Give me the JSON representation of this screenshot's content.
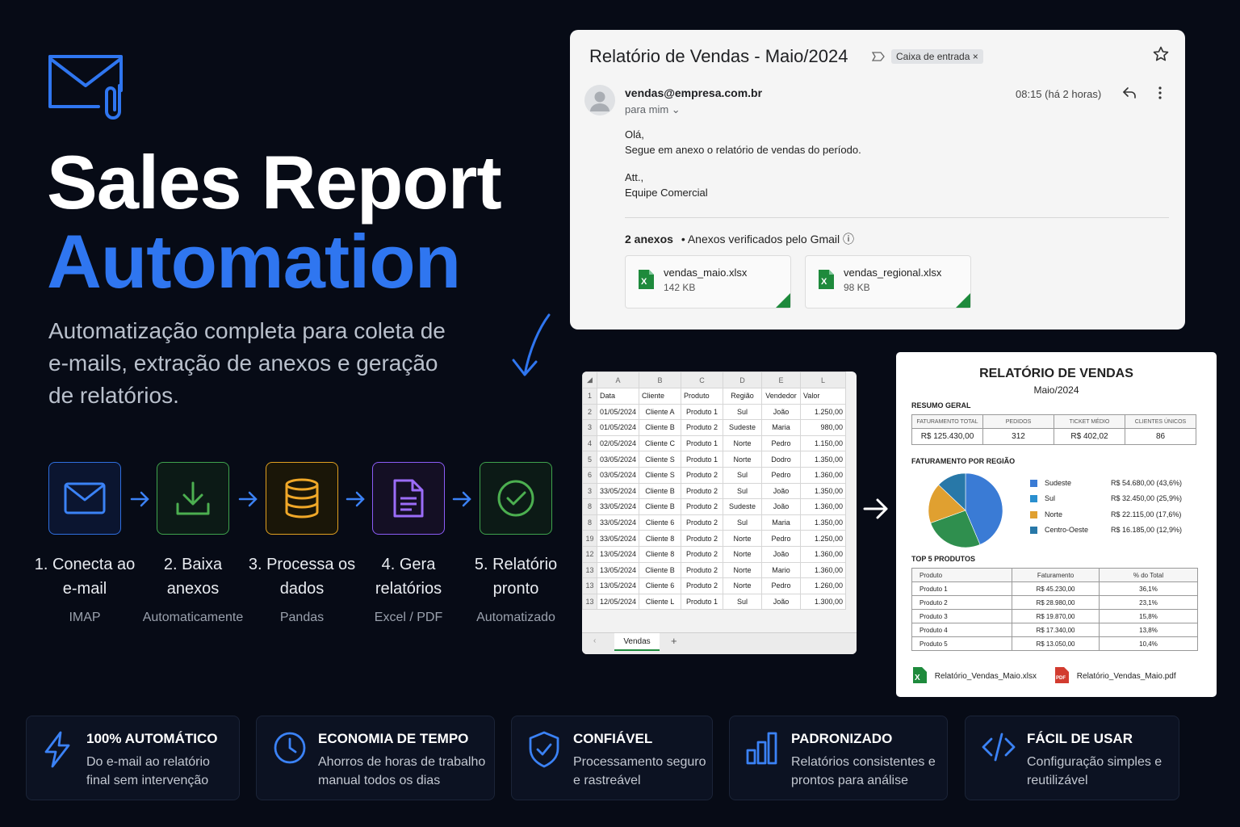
{
  "hero": {
    "title_line1": "Sales Report",
    "title_line2": "Automation",
    "subtitle": "Automatização completa para coleta de e-mails, extração de anexos e geração de relatórios."
  },
  "colors": {
    "accent": "#2f76f0",
    "background": "#070b16",
    "excel_green": "#1e8a3c"
  },
  "steps": [
    {
      "label": "1. Conecta ao e-mail",
      "sub": "IMAP",
      "icon": "mail-icon",
      "color": "#2f6fe0"
    },
    {
      "label": "2. Baixa anexos",
      "sub": "Automaticamente",
      "icon": "download-icon",
      "color": "#3fa34d"
    },
    {
      "label": "3. Processa os dados",
      "sub": "Pandas",
      "icon": "database-icon",
      "color": "#e0a020"
    },
    {
      "label": "4. Gera relatórios",
      "sub": "Excel / PDF",
      "icon": "document-icon",
      "color": "#8b5cf6"
    },
    {
      "label": "5. Relatório pronto",
      "sub": "Automatizado",
      "icon": "check-circle-icon",
      "color": "#3fa34d"
    }
  ],
  "email": {
    "subject": "Relatório de Vendas - Maio/2024",
    "label_chip": "Caixa de entrada ×",
    "sender": "vendas@empresa.com.br",
    "to": "para mim ⌄",
    "time": "08:15 (há 2 horas)",
    "body": [
      "Olá,",
      "Segue em anexo o relatório de vendas do período.",
      "",
      "Att.,",
      "Equipe Comercial"
    ],
    "attachments_count": "2 anexos",
    "attachments_note": "•  Anexos verificados pelo Gmail ⓘ",
    "attachments": [
      {
        "name": "vendas_maio.xlsx",
        "size": "142 KB"
      },
      {
        "name": "vendas_regional.xlsx",
        "size": "98 KB"
      }
    ]
  },
  "sheet": {
    "columns": [
      "A",
      "B",
      "C",
      "D",
      "E",
      "L"
    ],
    "headers": [
      "Data",
      "Cliente",
      "Produto",
      "Região",
      "Vendedor",
      "Valor"
    ],
    "row_numbers": [
      "1",
      "2",
      "3",
      "4",
      "5",
      "6",
      "3",
      "8",
      "8",
      "19",
      "12",
      "13",
      "13",
      "13"
    ],
    "rows": [
      [
        "01/05/2024",
        "Cliente A",
        "Produto 1",
        "Sul",
        "João",
        "1.250,00"
      ],
      [
        "01/05/2024",
        "Cliente B",
        "Produto 2",
        "Sudeste",
        "Maria",
        "980,00"
      ],
      [
        "02/05/2024",
        "Cliente C",
        "Produto 1",
        "Norte",
        "Pedro",
        "1.150,00"
      ],
      [
        "03/05/2024",
        "Cliente S",
        "Produto 1",
        "Norte",
        "Dodro",
        "1.350,00"
      ],
      [
        "03/05/2024",
        "Cliente S",
        "Produto 2",
        "Sul",
        "Pedro",
        "1.360,00"
      ],
      [
        "33/05/2024",
        "Cliente B",
        "Produto 2",
        "Sul",
        "João",
        "1.350,00"
      ],
      [
        "33/05/2024",
        "Cliente B",
        "Produto 2",
        "Sudeste",
        "João",
        "1.360,00"
      ],
      [
        "33/05/2024",
        "Cliente 6",
        "Produto 2",
        "Sul",
        "Maria",
        "1.350,00"
      ],
      [
        "33/05/2024",
        "Cliente 8",
        "Produto 2",
        "Norte",
        "Pedro",
        "1.250,00"
      ],
      [
        "13/05/2024",
        "Cliente 8",
        "Produto 2",
        "Norte",
        "João",
        "1.360,00"
      ],
      [
        "13/05/2024",
        "Cliente B",
        "Produto 2",
        "Norte",
        "Mario",
        "1.360,00"
      ],
      [
        "13/05/2024",
        "Cliente 6",
        "Produto 2",
        "Norte",
        "Pedro",
        "1.260,00"
      ],
      [
        "12/05/2024",
        "Cliente L",
        "Produto 1",
        "Sul",
        "João",
        "1.300,00"
      ]
    ],
    "tab": "Vendas",
    "add_tab": "+",
    "nav": "‹"
  },
  "report": {
    "title": "RELATÓRIO DE VENDAS",
    "month": "Maio/2024",
    "summary_title": "RESUMO GERAL",
    "kpi_headers": [
      "FATURAMENTO TOTAL",
      "PEDIDOS",
      "TICKET MÉDIO",
      "CLIENTES ÚNICOS"
    ],
    "kpi_values": [
      "R$ 125.430,00",
      "312",
      "R$ 402,02",
      "86"
    ],
    "region_title": "FATURAMENTO POR REGIÃO",
    "regions": [
      {
        "name": "Sudeste",
        "value": "R$ 54.680,00 (43,6%)",
        "share": 43.6,
        "color": "#3a7bd5"
      },
      {
        "name": "Sul",
        "value": "R$ 32.450,00 (25,9%)",
        "share": 25.9,
        "color": "#2f8f4e"
      },
      {
        "name": "Norte",
        "value": "R$ 22.115,00 (17,6%)",
        "share": 17.6,
        "color": "#e0a030"
      },
      {
        "name": "Centro-Oeste",
        "value": "R$ 16.185,00 (12,9%)",
        "share": 12.9,
        "color": "#2878a8"
      }
    ],
    "products_title": "TOP 5 PRODUTOS",
    "product_headers": [
      "Produto",
      "Faturamento",
      "% do Total"
    ],
    "products": [
      [
        "Produto 1",
        "R$ 45.230,00",
        "36,1%"
      ],
      [
        "Produto 2",
        "R$ 28.980,00",
        "23,1%"
      ],
      [
        "Produto 3",
        "R$ 19.870,00",
        "15,8%"
      ],
      [
        "Produto 4",
        "R$ 17.340,00",
        "13,8%"
      ],
      [
        "Produto 5",
        "R$ 13.050,00",
        "10,4%"
      ]
    ],
    "files": [
      "Relatório_Vendas_Maio.xlsx",
      "Relatório_Vendas_Maio.pdf"
    ],
    "pdf_badge": "PDF"
  },
  "features": [
    {
      "title": "100% AUTOMÁTICO",
      "desc": "Do e-mail ao relatório final sem intervenção",
      "icon": "lightning-icon"
    },
    {
      "title": "ECONOMIA DE TEMPO",
      "desc": "Ahorros de horas de trabalho manual todos os dias",
      "icon": "clock-icon"
    },
    {
      "title": "CONFIÁVEL",
      "desc": "Processamento seguro e rastreável",
      "icon": "shield-icon"
    },
    {
      "title": "PADRONIZADO",
      "desc": "Relatórios consistentes e prontos para análise",
      "icon": "bar-chart-icon"
    },
    {
      "title": "FÁCIL DE USAR",
      "desc": "Configuração simples e reutilizável",
      "icon": "code-icon"
    }
  ]
}
